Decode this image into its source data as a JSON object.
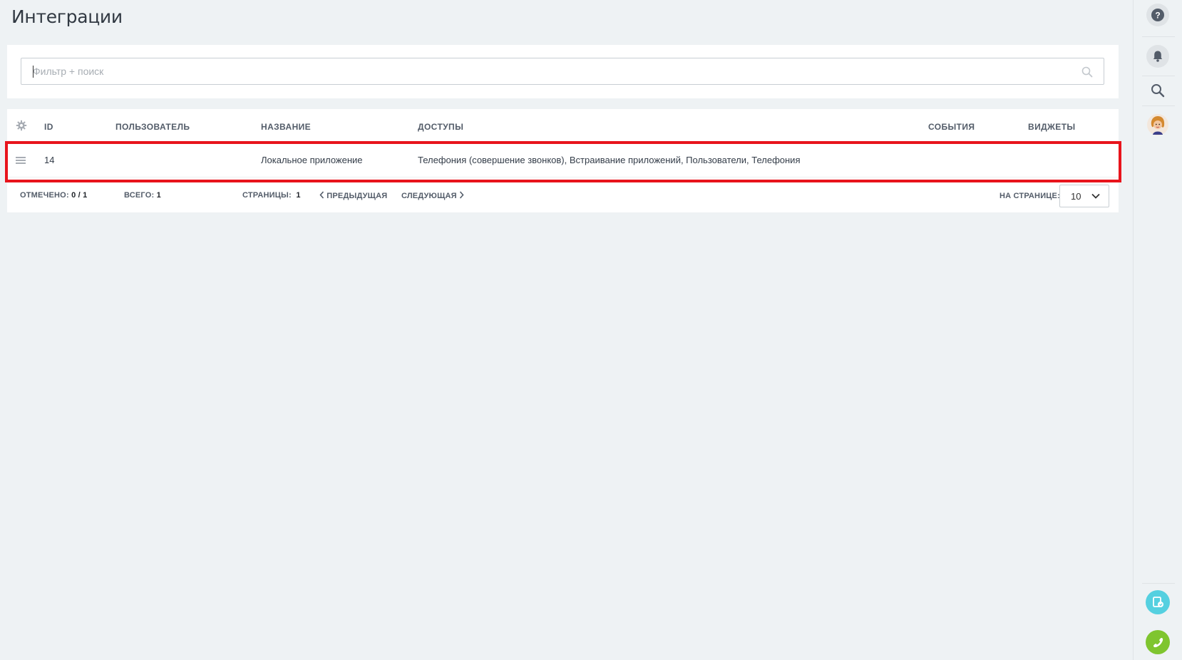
{
  "page": {
    "title": "Интеграции"
  },
  "filter": {
    "placeholder": "Фильтр + поиск",
    "value": ""
  },
  "grid": {
    "columns": {
      "id": "ID",
      "user": "ПОЛЬЗОВАТЕЛЬ",
      "name": "НАЗВАНИЕ",
      "access": "ДОСТУПЫ",
      "events": "СОБЫТИЯ",
      "widgets": "ВИДЖЕТЫ"
    },
    "rows": [
      {
        "id": "14",
        "user": "",
        "name": "Локальное приложение",
        "access": "Телефония (совершение звонков), Встраивание приложений, Пользователи, Телефония",
        "events": "",
        "widgets": ""
      }
    ]
  },
  "footer": {
    "selected_label": "ОТМЕЧЕНО:",
    "selected_value": "0 / 1",
    "total_label": "ВСЕГО:",
    "total_value": "1",
    "pages_label": "СТРАНИЦЫ:",
    "pages_value": "1",
    "prev_label": "ПРЕДЫДУЩАЯ",
    "next_label": "СЛЕДУЮЩАЯ",
    "per_page_label": "НА СТРАНИЦЕ:",
    "per_page_value": "10"
  },
  "colors": {
    "highlight": "#e8141c",
    "chat_button": "#55d0e0",
    "phone_button": "#7fc52f"
  },
  "icons": [
    "gear-icon",
    "search-icon",
    "help-icon",
    "bell-icon",
    "avatar",
    "drag-handle-icon",
    "chevron-left-icon",
    "chevron-right-icon",
    "chevron-down-icon",
    "chat-icon",
    "phone-icon"
  ]
}
